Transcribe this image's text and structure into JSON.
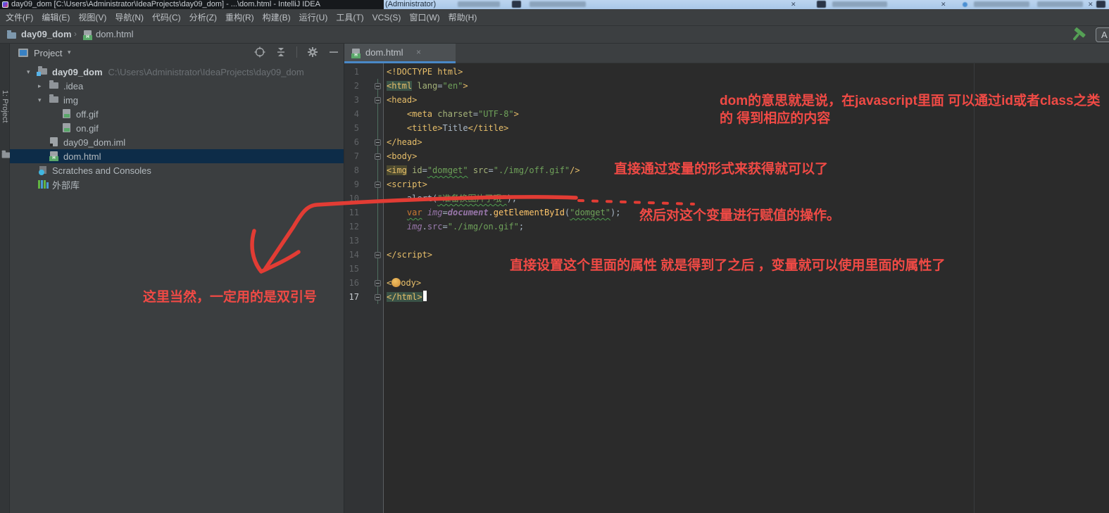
{
  "window": {
    "title_main": "day09_dom [C:\\Users\\Administrator\\IdeaProjects\\day09_dom] - ...\\dom.html - IntelliJ IDEA ",
    "title_admin": "(Administrator)"
  },
  "menu": {
    "items": [
      "文件(F)",
      "编辑(E)",
      "视图(V)",
      "导航(N)",
      "代码(C)",
      "分析(Z)",
      "重构(R)",
      "构建(B)",
      "运行(U)",
      "工具(T)",
      "VCS(S)",
      "窗口(W)",
      "帮助(H)"
    ]
  },
  "breadcrumb": {
    "project": "day09_dom",
    "separator": "›",
    "file": "dom.html"
  },
  "toolbar": {
    "build_icon": "hammer-icon",
    "ime_indicator": "A"
  },
  "tool_stripe": {
    "label": "1: Project"
  },
  "project_panel": {
    "title": "Project",
    "header_icons": [
      "locate-icon",
      "collapse-all-icon",
      "settings-gear-icon",
      "hide-icon"
    ],
    "items": [
      {
        "pl": 24,
        "arrow": "▾",
        "icon": "rootfolder",
        "label": "day09_dom",
        "bold": true,
        "sub": "C:\\Users\\Administrator\\IdeaProjects\\day09_dom"
      },
      {
        "pl": 40,
        "arrow": "▸",
        "icon": "folder",
        "label": ".idea"
      },
      {
        "pl": 40,
        "arrow": "▾",
        "icon": "folder",
        "label": "img"
      },
      {
        "pl": 58,
        "arrow": "",
        "icon": "img",
        "label": "off.gif"
      },
      {
        "pl": 58,
        "arrow": "",
        "icon": "img",
        "label": "on.gif"
      },
      {
        "pl": 40,
        "arrow": "",
        "icon": "iml",
        "label": "day09_dom.iml"
      },
      {
        "pl": 40,
        "arrow": "",
        "icon": "html",
        "label": "dom.html",
        "selected": true
      },
      {
        "pl": 24,
        "arrow": "",
        "icon": "scratch",
        "label": "Scratches and Consoles"
      },
      {
        "pl": 24,
        "arrow": "",
        "icon": "libs",
        "label": "外部库"
      }
    ]
  },
  "editor": {
    "tab": {
      "label": "dom.html",
      "close": "×"
    },
    "lines": [
      {
        "n": 1,
        "t": [
          [
            "tag",
            "<!DOCTYPE html>"
          ]
        ]
      },
      {
        "n": 2,
        "fold": "s",
        "t": [
          [
            "tag hlA",
            "<html"
          ],
          [
            "def",
            " "
          ],
          [
            "attr",
            "lang"
          ],
          [
            "def",
            "="
          ],
          [
            "str",
            "\"en\""
          ],
          [
            "tag",
            ">"
          ]
        ]
      },
      {
        "n": 3,
        "fold": "s",
        "t": [
          [
            "tag",
            "<head>"
          ]
        ]
      },
      {
        "n": 4,
        "t": [
          [
            "def",
            "    "
          ],
          [
            "tag",
            "<meta"
          ],
          [
            "def",
            " "
          ],
          [
            "attr",
            "charset"
          ],
          [
            "def",
            "="
          ],
          [
            "str",
            "\"UTF-8\""
          ],
          [
            "tag",
            ">"
          ]
        ]
      },
      {
        "n": 5,
        "t": [
          [
            "def",
            "    "
          ],
          [
            "tag",
            "<title>"
          ],
          [
            "def",
            "Title"
          ],
          [
            "tag",
            "</title>"
          ]
        ]
      },
      {
        "n": 6,
        "fold": "e",
        "t": [
          [
            "tag",
            "</head>"
          ]
        ]
      },
      {
        "n": 7,
        "fold": "s",
        "t": [
          [
            "tag",
            "<body>"
          ]
        ]
      },
      {
        "n": 8,
        "t": [
          [
            "tag hlB",
            "<img"
          ],
          [
            "def",
            " "
          ],
          [
            "attr",
            "id"
          ],
          [
            "def",
            "="
          ],
          [
            "str wavy",
            "\"domget\""
          ],
          [
            "def",
            " "
          ],
          [
            "attr",
            "src"
          ],
          [
            "def",
            "="
          ],
          [
            "str",
            "\"./img/off.gif\""
          ],
          [
            "tag",
            "/>"
          ]
        ]
      },
      {
        "n": 9,
        "fold": "s",
        "t": [
          [
            "tag",
            "<script>"
          ]
        ]
      },
      {
        "n": 10,
        "t": [
          [
            "def",
            "    alert("
          ],
          [
            "str wavy",
            "\"准备换图片了哦\""
          ],
          [
            "def",
            ");"
          ]
        ]
      },
      {
        "n": 11,
        "t": [
          [
            "def",
            "    "
          ],
          [
            "kw wavy",
            "var"
          ],
          [
            "def",
            " "
          ],
          [
            "var",
            "img"
          ],
          [
            "def",
            "="
          ],
          [
            "var bold",
            "document"
          ],
          [
            "def",
            "."
          ],
          [
            "fn",
            "getElementById"
          ],
          [
            "def",
            "("
          ],
          [
            "str wavy",
            "\"domget\""
          ],
          [
            "def",
            ");"
          ]
        ]
      },
      {
        "n": 12,
        "t": [
          [
            "def",
            "    "
          ],
          [
            "var",
            "img"
          ],
          [
            "def",
            "."
          ],
          [
            "prop",
            "src"
          ],
          [
            "def",
            "="
          ],
          [
            "str",
            "\"./img/on.gif\""
          ],
          [
            "def",
            ";"
          ]
        ]
      },
      {
        "n": 13,
        "t": []
      },
      {
        "n": 14,
        "fold": "e",
        "t": [
          [
            "tag",
            "</script>"
          ]
        ]
      },
      {
        "n": 15,
        "t": []
      },
      {
        "n": 16,
        "fold": "e",
        "t": [
          [
            "tag",
            "<"
          ],
          [
            "bulb",
            ""
          ],
          [
            "tag",
            "ody>"
          ]
        ]
      },
      {
        "n": 17,
        "fold": "e",
        "cur": true,
        "t": [
          [
            "tag hlA",
            "</html>"
          ],
          [
            "caret",
            ""
          ]
        ]
      }
    ]
  },
  "annotations": {
    "a1_line1": "dom的意思就是说，在javascript里面 可以通过id或者class之类",
    "a1_line2": "的 得到相应的内容",
    "a2": "直接通过变量的形式来获得就可以了",
    "a3": "然后对这个变量进行赋值的操作。",
    "a4": "直接设置这个里面的属性   就是得到了之后 ，变量就可以使用里面的属性了",
    "a5": "这里当然，一定用的是双引号"
  },
  "colors": {
    "annotation_red": "#f04a45",
    "arrow_red": "#e23c34",
    "selection_blue": "#0d2c48",
    "tab_underline": "#4a88c7"
  }
}
